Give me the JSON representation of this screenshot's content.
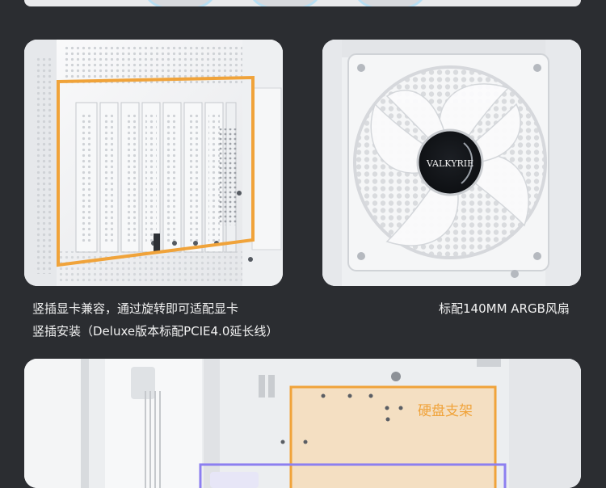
{
  "captions": {
    "vertical_gpu_line1": "竖插显卡兼容，通过旋转即可适配显卡",
    "vertical_gpu_line2": "竖插安装（Deluxe版本标配PCIE4.0延长线）",
    "fan": "标配140MM ARGB风扇"
  },
  "fan_logo": "VALKYRIE",
  "drive_bracket_label": "硬盘支架",
  "colors": {
    "background": "#2b2d31",
    "highlight_orange": "#f0a33a",
    "highlight_purple": "#8c7ff0",
    "caption_text": "#f2f2f2"
  }
}
